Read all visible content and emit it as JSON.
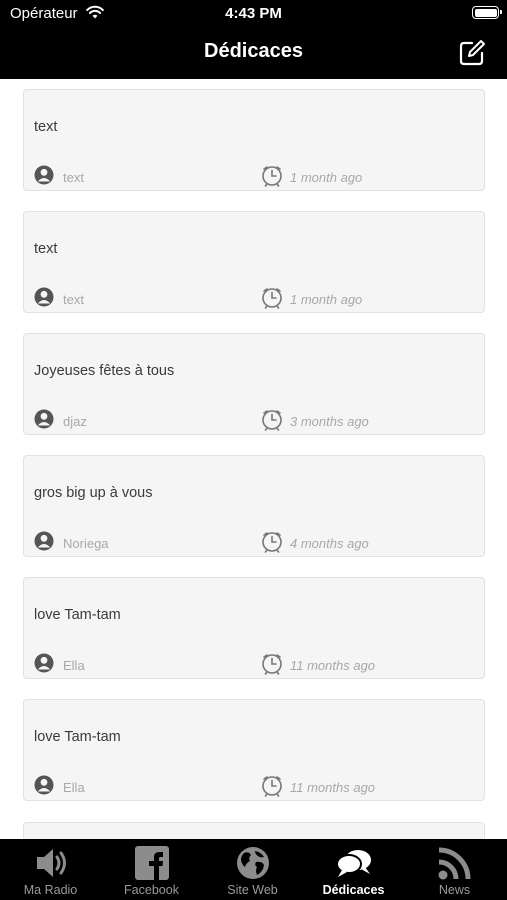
{
  "status_bar": {
    "carrier": "Opérateur",
    "time": "4:43 PM"
  },
  "nav": {
    "title": "Dédicaces",
    "compose_icon": "compose-icon"
  },
  "dedications": [
    {
      "message": "text",
      "author": "text",
      "time_ago": "1 month ago"
    },
    {
      "message": "text",
      "author": "text",
      "time_ago": "1 month ago"
    },
    {
      "message": "Joyeuses fêtes à tous",
      "author": "djaz",
      "time_ago": "3 months ago"
    },
    {
      "message": "gros big up à vous",
      "author": "Noriega",
      "time_ago": "4 months ago"
    },
    {
      "message": "love Tam-tam",
      "author": "Ella",
      "time_ago": "11 months ago"
    },
    {
      "message": "love Tam-tam",
      "author": "Ella",
      "time_ago": "11 months ago"
    }
  ],
  "tabs": [
    {
      "label": "Ma Radio",
      "icon": "speaker-icon"
    },
    {
      "label": "Facebook",
      "icon": "facebook-icon"
    },
    {
      "label": "Site Web",
      "icon": "globe-icon"
    },
    {
      "label": "Dédicaces",
      "icon": "chat-bubbles-icon",
      "active": true
    },
    {
      "label": "News",
      "icon": "rss-icon"
    }
  ],
  "colors": {
    "bar_background": "#000000",
    "card_background": "#f5f5f5",
    "muted_text": "#a8a8a8",
    "active_tab": "#ffffff",
    "inactive_tab": "#9a9a9a"
  }
}
